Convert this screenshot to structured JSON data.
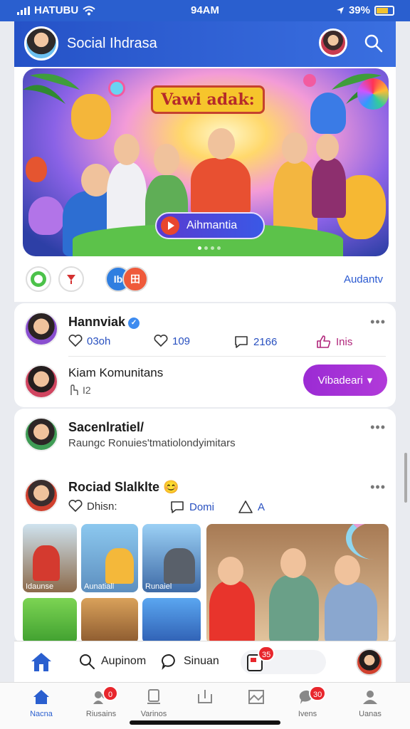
{
  "status_bar": {
    "carrier": "HATUBU",
    "time": "94AM",
    "battery": "39%"
  },
  "header": {
    "title": "Social Ihdrasa",
    "avatar": "user-avatar",
    "profile": "profile-avatar",
    "search_icon": "search-icon"
  },
  "banner": {
    "ribbon_text": "Vawi adak:",
    "cta_label": "Aihmantia"
  },
  "chips": {
    "link_label": "Audantv"
  },
  "post1": {
    "author": "Hannviak",
    "verified_mark": "✓",
    "stats": {
      "views": "03oh",
      "likes": "109",
      "comments": "2166",
      "shares": "Inis"
    },
    "menu": "•••",
    "sub_author": "Kiam Komunitans",
    "sub_meta": "I2",
    "button_label": "Vibadeari"
  },
  "post2": {
    "title": "Sacenlratiel/",
    "subtitle": "Raungc Ronuies'tmatiolondyimitars",
    "menu": "•••"
  },
  "post3": {
    "author": "Rociad Slalklte",
    "emoji": "😊",
    "stats": {
      "like": "Dhisn:",
      "comment": "Domi",
      "share": "A"
    },
    "menu": "•••",
    "thumbs": [
      "Idaunse",
      "Aunatiall",
      "Runaiel"
    ]
  },
  "action_bar": {
    "item1": "Aupinom",
    "item2": "Sinuan",
    "badge": "35"
  },
  "bottom_nav": {
    "items": [
      {
        "label": "Nacna"
      },
      {
        "label": "Riusains",
        "badge": "0"
      },
      {
        "label": "Varinos"
      },
      {
        "label": ""
      },
      {
        "label": ""
      },
      {
        "label": "Ivens",
        "badge": "30"
      },
      {
        "label": "Uanas"
      }
    ]
  },
  "colors": {
    "brand_blue": "#2a5fcf",
    "accent_purple": "#a533d6",
    "badge_red": "#e8262c"
  }
}
